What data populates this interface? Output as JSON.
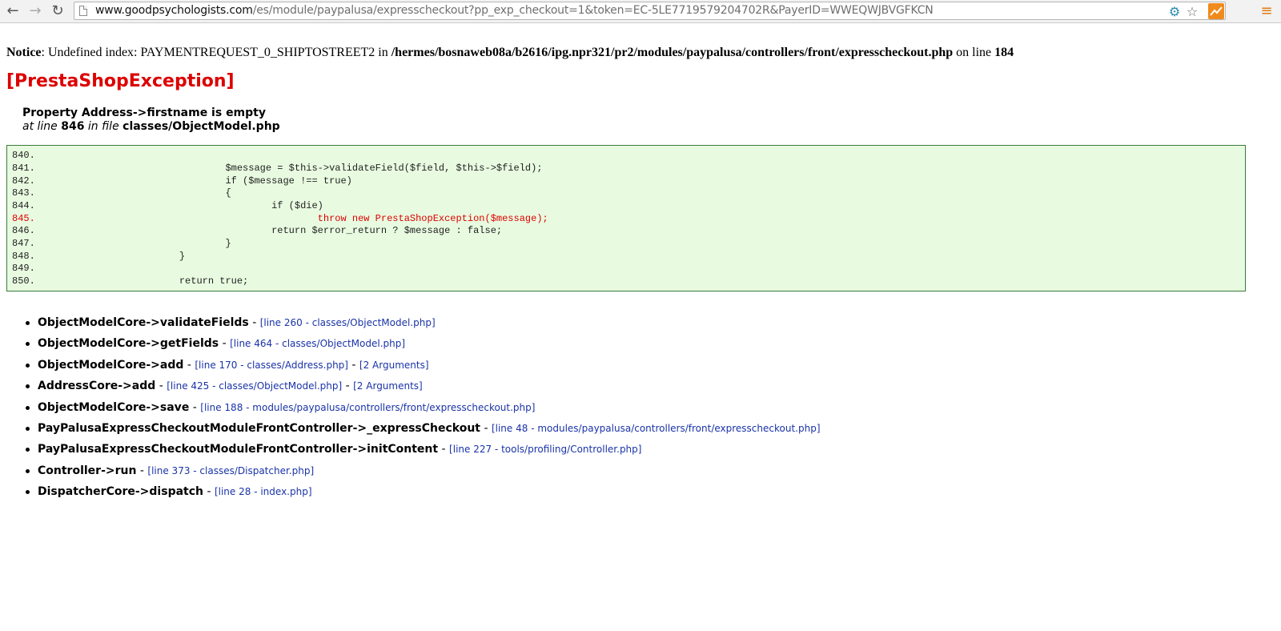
{
  "browser": {
    "url_host": "www.goodpsychologists.com",
    "url_path": "/es/module/paypalusa/expresscheckout?pp_exp_checkout=1&token=EC-5LE7719579204702R&PayerID=WWEQWJBVGFKCN",
    "back_icon": "←",
    "forward_icon": "→",
    "reload_icon": "↻",
    "star_icon": "☆",
    "extension_icon": "⚙",
    "menu_icon": "≡"
  },
  "notice": {
    "label": "Notice",
    "text_before": ": Undefined index: PAYMENTREQUEST_0_SHIPTOSTREET2 in ",
    "file": "/hermes/bosnaweb08a/b2616/ipg.npr321/pr2/modules/paypalusa/controllers/front/expresscheckout.php",
    "on_line_text": " on line ",
    "line": "184"
  },
  "exception": {
    "title": "[PrestaShopException]",
    "message": "Property Address->firstname is empty",
    "at_line_text": "at line ",
    "line": "846",
    "in_file_text": " in file ",
    "file": "classes/ObjectModel.php"
  },
  "code": [
    {
      "num": "840.",
      "text": ""
    },
    {
      "num": "841.",
      "text": "\t\t\t$message = $this->validateField($field, $this->$field);"
    },
    {
      "num": "842.",
      "text": "\t\t\tif ($message !== true)"
    },
    {
      "num": "843.",
      "text": "\t\t\t{"
    },
    {
      "num": "844.",
      "text": "\t\t\t\tif ($die)"
    },
    {
      "num": "845.",
      "text": "\t\t\t\t\tthrow new PrestaShopException($message);",
      "highlight": true
    },
    {
      "num": "846.",
      "text": "\t\t\t\treturn $error_return ? $message : false;"
    },
    {
      "num": "847.",
      "text": "\t\t\t}"
    },
    {
      "num": "848.",
      "text": "\t\t}"
    },
    {
      "num": "849.",
      "text": ""
    },
    {
      "num": "850.",
      "text": "\t\treturn true;"
    }
  ],
  "trace": [
    {
      "fn": "ObjectModelCore->validateFields",
      "ref": "[line 260 - classes/ObjectModel.php]"
    },
    {
      "fn": "ObjectModelCore->getFields",
      "ref": "[line 464 - classes/ObjectModel.php]"
    },
    {
      "fn": "ObjectModelCore->add",
      "ref": "[line 170 - classes/Address.php]",
      "args": "[2 Arguments]"
    },
    {
      "fn": "AddressCore->add",
      "ref": "[line 425 - classes/ObjectModel.php]",
      "args": "[2 Arguments]"
    },
    {
      "fn": "ObjectModelCore->save",
      "ref": "[line 188 - modules/paypalusa/controllers/front/expresscheckout.php]"
    },
    {
      "fn": "PayPalusaExpressCheckoutModuleFrontController->_expressCheckout",
      "ref": "[line 48 - modules/paypalusa/controllers/front/expresscheckout.php]"
    },
    {
      "fn": "PayPalusaExpressCheckoutModuleFrontController->initContent",
      "ref": "[line 227 - tools/profiling/Controller.php]"
    },
    {
      "fn": "Controller->run",
      "ref": "[line 373 - classes/Dispatcher.php]"
    },
    {
      "fn": "DispatcherCore->dispatch",
      "ref": "[line 28 - index.php]"
    }
  ],
  "colors": {
    "exception_red": "#dd0000",
    "code_bg": "#e8fbe0",
    "link_blue": "#1a33a8",
    "extension_orange": "#f08a1c"
  }
}
